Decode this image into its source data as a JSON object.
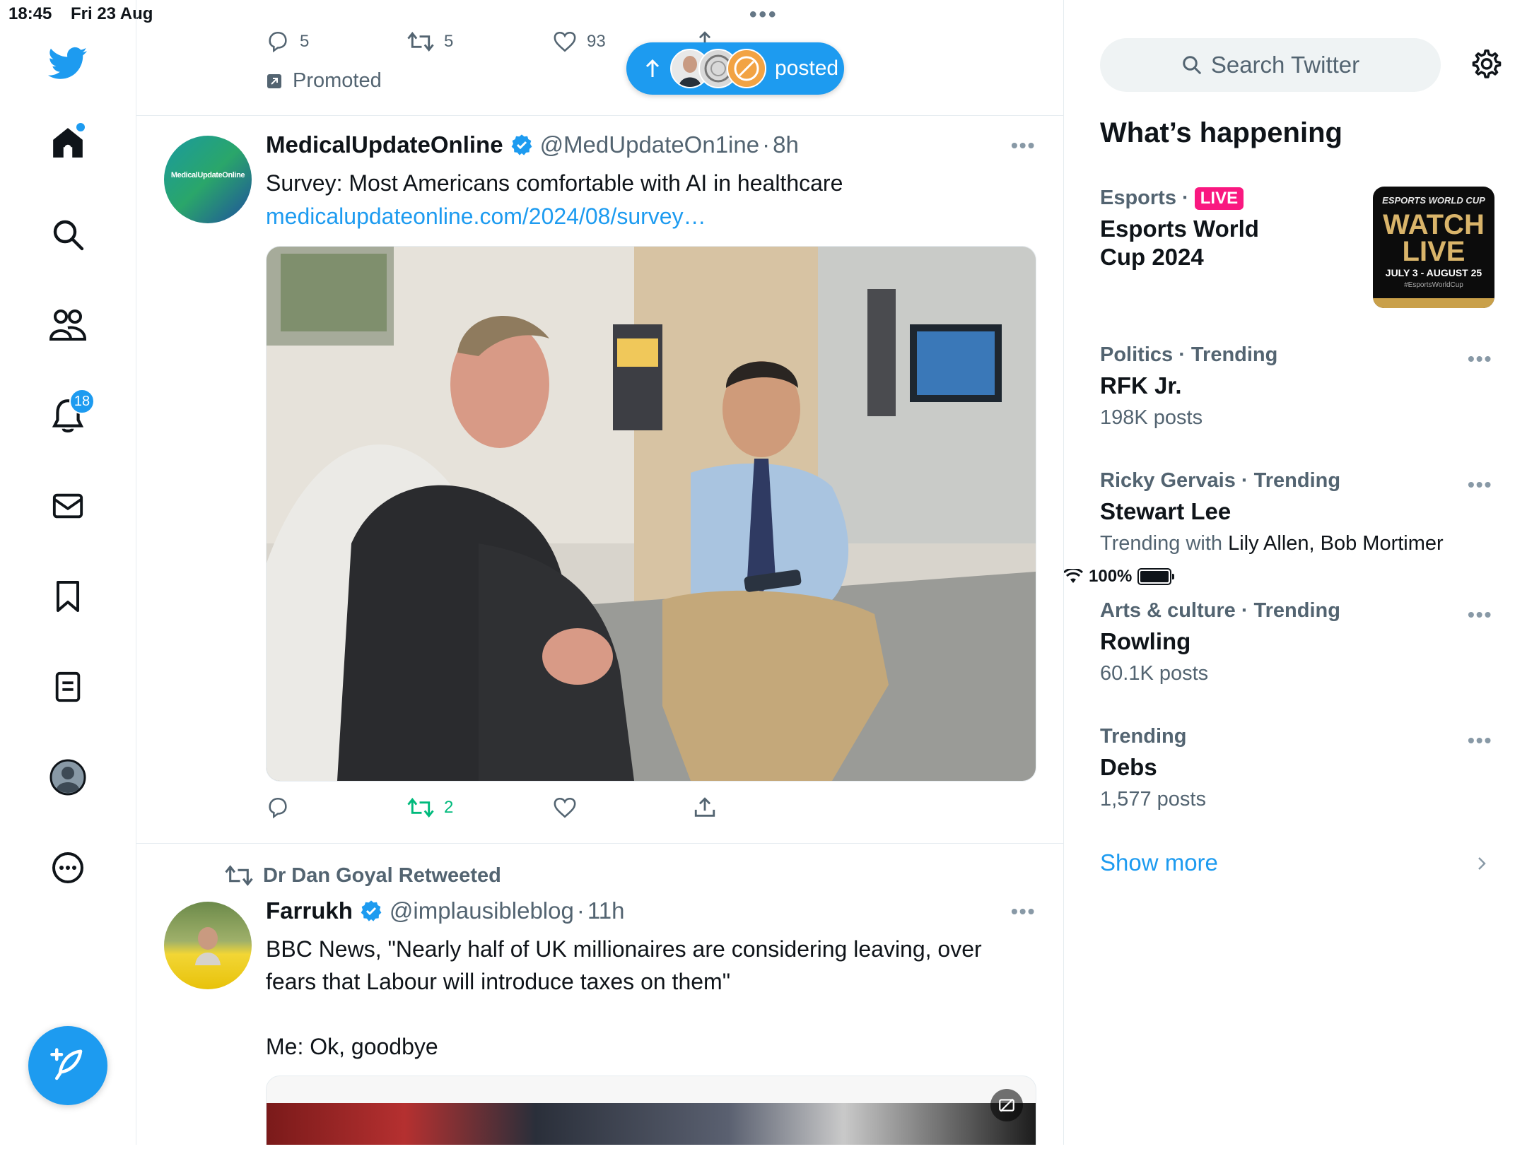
{
  "status_bar": {
    "time": "18:45",
    "date": "Fri 23 Aug",
    "dots": "•••",
    "battery": "100%"
  },
  "nav": {
    "notifications_badge": "18",
    "icons": [
      "twitter-logo-icon",
      "home-icon",
      "search-icon",
      "communities-icon",
      "notifications-icon",
      "messages-icon",
      "bookmarks-icon",
      "lists-icon",
      "profile-icon",
      "more-icon",
      "compose-icon"
    ]
  },
  "posted_pill": {
    "label": "posted"
  },
  "prev_tweet": {
    "reply_count": "5",
    "retweet_count": "5",
    "like_count": "93",
    "promoted_label": "Promoted"
  },
  "tweet1": {
    "name": "MedicalUpdateOnline",
    "handle": "@MedUpdateOn1ine",
    "sep": "·",
    "time": "8h",
    "text": "Survey: Most Americans comfortable with AI in healthcare",
    "link": "medicalupdateonline.com/2024/08/survey…",
    "avatar_text": "MedicalUpdateOnline",
    "retweet_count": "2"
  },
  "tweet2": {
    "retweeted_by": "Dr Dan Goyal Retweeted",
    "name": "Farrukh",
    "handle": "@implausibleblog",
    "sep": "·",
    "time": "11h",
    "text_line1": "BBC News, \"Nearly half of UK millionaires are considering leaving, over",
    "text_line2": "fears that Labour will introduce taxes on them\"",
    "text_line3": "Me: Ok, goodbye"
  },
  "sidebar": {
    "search_placeholder": "Search Twitter",
    "section_title": "What’s happening",
    "trends": [
      {
        "meta": "Esports ·",
        "live": "LIVE",
        "title_line1": "Esports World",
        "title_line2": "Cup 2024",
        "promo_top": "ESPORTS WORLD CUP",
        "promo_main1": "WATCH",
        "promo_main2": "LIVE",
        "promo_dates": "JULY 3 - AUGUST 25",
        "promo_tag": "#EsportsWorldCup"
      },
      {
        "meta": "Politics · Trending",
        "title": "RFK Jr.",
        "sub": "198K posts"
      },
      {
        "meta": "Ricky Gervais · Trending",
        "title": "Stewart Lee",
        "sub_prefix": "Trending with ",
        "sub_names": "Lily Allen, Bob Mortimer"
      },
      {
        "meta": "Arts & culture · Trending",
        "title": "Rowling",
        "sub": "60.1K posts"
      },
      {
        "meta": "Trending",
        "title": "Debs",
        "sub": "1,577 posts"
      }
    ],
    "show_more": "Show more"
  },
  "colors": {
    "accent": "#1d9bf0",
    "live": "#f91880",
    "retweet_green": "#00ba7c",
    "text_secondary": "#536471"
  }
}
